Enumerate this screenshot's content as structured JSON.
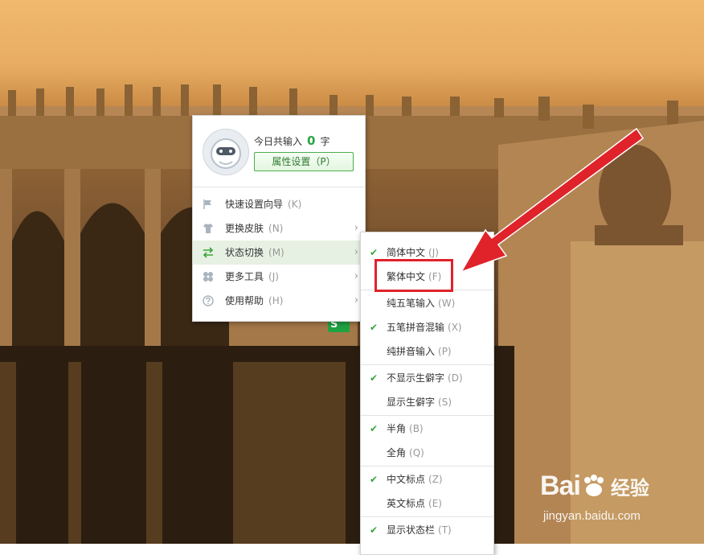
{
  "main_menu": {
    "today_prefix": "今日共输入",
    "today_count": "0",
    "today_suffix": "字",
    "settings_button": "属性设置（P）",
    "items": [
      {
        "label": "快速设置向导",
        "key": "(K)",
        "icon": "flag-icon"
      },
      {
        "label": "更换皮肤",
        "key": "(N)",
        "icon": "shirt-icon"
      },
      {
        "label": "状态切换",
        "key": "(M)",
        "icon": "switch-arrows-icon"
      },
      {
        "label": "更多工具",
        "key": "(J)",
        "icon": "tools-icon"
      },
      {
        "label": "使用帮助",
        "key": "(H)",
        "icon": "help-circle-icon"
      }
    ]
  },
  "submenu": {
    "items": [
      {
        "label": "简体中文",
        "key": "(J)",
        "checked": true
      },
      {
        "label": "繁体中文",
        "key": "(F)",
        "checked": false
      },
      {
        "label": "纯五笔输入",
        "key": "(W)",
        "checked": false
      },
      {
        "label": "五笔拼音混输",
        "key": "(X)",
        "checked": true
      },
      {
        "label": "纯拼音输入",
        "key": "(P)",
        "checked": false
      },
      {
        "label": "不显示生僻字",
        "key": "(D)",
        "checked": true
      },
      {
        "label": "显示生僻字",
        "key": "(S)",
        "checked": false
      },
      {
        "label": "半角",
        "key": "(B)",
        "checked": true
      },
      {
        "label": "全角",
        "key": "(Q)",
        "checked": false
      },
      {
        "label": "中文标点",
        "key": "(Z)",
        "checked": true
      },
      {
        "label": "英文标点",
        "key": "(E)",
        "checked": false
      },
      {
        "label": "显示状态栏",
        "key": "(T)",
        "checked": true
      }
    ]
  },
  "check_mark": "✔",
  "arrow_glyph": "›",
  "watermark": {
    "logo_left": "Bai",
    "logo_right": "经验",
    "url": "jingyan.baidu.com"
  },
  "taskbar_badge": "S",
  "colors": {
    "accent_green": "#28a745",
    "highlight_red": "#e0222a"
  }
}
